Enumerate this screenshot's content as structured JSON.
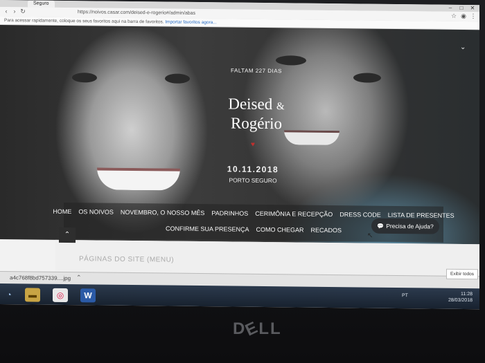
{
  "browser": {
    "tab_title": "Seguro",
    "url": "https://noivos.casar.com/deised-e-rogerio#/admin/abas",
    "bookmarks_hint": "Para acessar rapidamente, coloque os seus favoritos aqui na barra de favoritos.",
    "bookmarks_link": "Importar favoritos agora..."
  },
  "hero": {
    "countdown": "FALTAM 227 DIAS",
    "name1": "Deised",
    "ampersand": "&",
    "name2": "Rogério",
    "date": "10.11.2018",
    "city": "PORTO SEGURO"
  },
  "menu": {
    "row1": [
      "HOME",
      "OS NOIVOS",
      "NOVEMBRO, O NOSSO MÊS",
      "PADRINHOS",
      "CERIMÔNIA E RECEPÇÃO",
      "DRESS CODE",
      "LISTA DE PRESENTES"
    ],
    "row2": [
      "CONFIRME SUA PRESENÇA",
      "COMO CHEGAR",
      "RECADOS"
    ]
  },
  "content": {
    "section_title": "PÁGINAS DO SITE (MENU)"
  },
  "help_button": {
    "label": "Precisa de Ajuda?"
  },
  "download_bar": {
    "file_name": "a4c768f8bd757339....jpg",
    "show_all": "Exibir todos"
  },
  "taskbar": {
    "tray_lang": "PT",
    "time": "11:28",
    "date": "28/03/2018"
  },
  "bezel": {
    "brand": "DELL"
  },
  "colors": {
    "menu_bg": "#232323",
    "help_bg": "#2b2f33",
    "heart": "#c0302e",
    "taskbar": "#18222f"
  }
}
